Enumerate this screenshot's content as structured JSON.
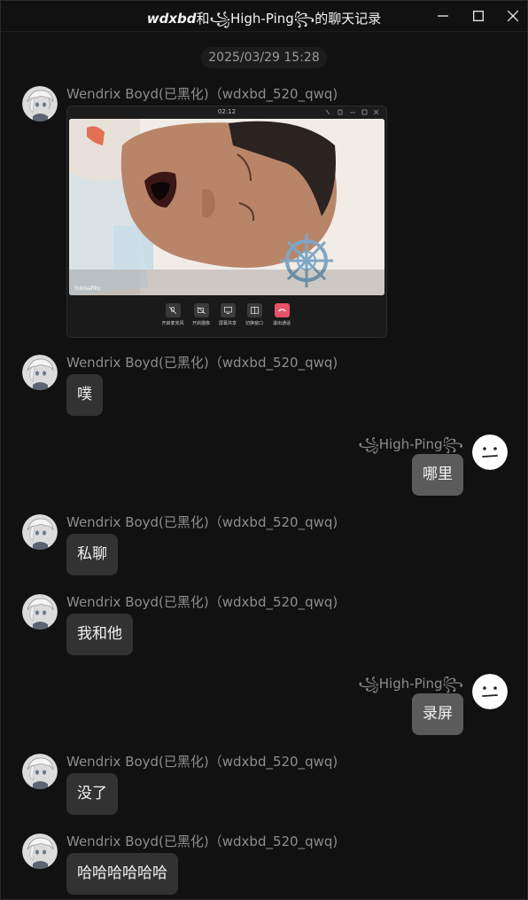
{
  "window": {
    "title_part1": "wdxbd",
    "title_part2": "和",
    "title_part3": "꧁High-Ping꧂",
    "title_part4": "的聊天记录"
  },
  "timestamp": "2025/03/29 15:28",
  "senders": {
    "wendrix": "Wendrix Boyd(已黑化)（wdxbd_520_qwq)",
    "highping": "꧁High-Ping꧂"
  },
  "screenshot": {
    "time": "02:12",
    "caller_name": "Yukisafiku",
    "controls": [
      "开启麦克风",
      "开启摄像",
      "屏幕共享",
      "切换窗口",
      "退出通话"
    ]
  },
  "messages": [
    {
      "sender": "wendrix",
      "text": "噗"
    },
    {
      "sender": "highping",
      "text": "哪里"
    },
    {
      "sender": "wendrix",
      "text": "私聊"
    },
    {
      "sender": "wendrix",
      "text": "我和他"
    },
    {
      "sender": "highping",
      "text": "录屏"
    },
    {
      "sender": "wendrix",
      "text": "没了"
    },
    {
      "sender": "wendrix",
      "text": "哈哈哈哈哈哈"
    }
  ],
  "colors": {
    "background": "#111111",
    "bubble_left": "#323232",
    "bubble_right": "#5b5b5b",
    "sender_text": "#8d8d8d",
    "hangup": "#e8526a"
  }
}
